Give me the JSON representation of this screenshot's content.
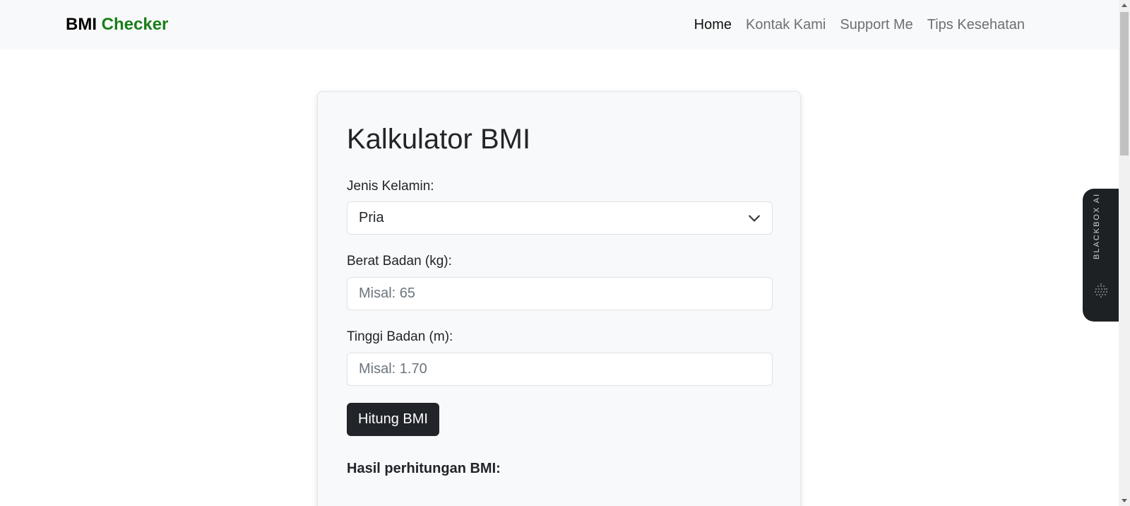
{
  "navbar": {
    "brand_part1": "BMI",
    "brand_part2": "Checker",
    "links": [
      {
        "label": "Home",
        "active": true
      },
      {
        "label": "Kontak Kami",
        "active": false
      },
      {
        "label": "Support Me",
        "active": false
      },
      {
        "label": "Tips Kesehatan",
        "active": false
      }
    ]
  },
  "form": {
    "title": "Kalkulator BMI",
    "gender_label": "Jenis Kelamin:",
    "gender_value": "Pria",
    "weight_label": "Berat Badan (kg):",
    "weight_placeholder": "Misal: 65",
    "height_label": "Tinggi Badan (m):",
    "height_placeholder": "Misal: 1.70",
    "submit_label": "Hitung BMI",
    "result_heading": "Hasil perhitungan BMI:"
  },
  "side_widget": {
    "label": "BLACKBOX AI",
    "icon": "blackbox-logo-icon"
  },
  "colors": {
    "brand_accent": "#1a7f1a",
    "button_bg": "#212529",
    "navbar_bg": "#f8f9fa",
    "widget_bg": "#1e2124"
  }
}
